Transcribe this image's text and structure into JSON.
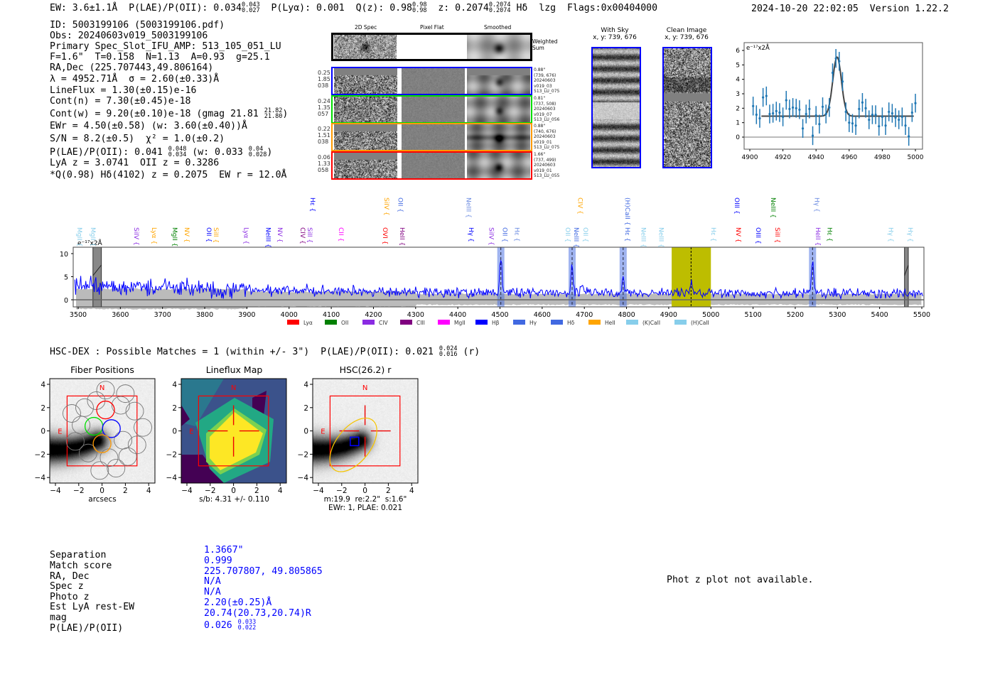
{
  "header": {
    "ew": "EW: 3.6±1.1Å",
    "plae_label": "P(LAE)/P(OII): 0.034",
    "plae_hi": "0.043",
    "plae_lo": "0.027",
    "plya": "P(Lyα): 0.001",
    "q_label": "Q(z): 0.98",
    "q_hi": "0.98",
    "q_lo": "0.98",
    "z_label": "z: 0.2074",
    "z_hi": "0.2074",
    "z_lo": "0.2074",
    "line": "Hδ",
    "lzg": "lzg",
    "flags": "Flags:0x00404000",
    "datetime": "2024-10-20 22:02:05",
    "version": "Version 1.22.2"
  },
  "info": {
    "lines": [
      "ID: 5003199106 (5003199106.pdf)",
      "Obs: 20240603v019_5003199106",
      "Primary Spec_Slot_IFU_AMP: 513_105_051_LU",
      "F=1.6\"  T=0.158  N=1.13  A=0.93  g=25.1",
      "RA,Dec (225.707443,49.806164)",
      "λ = 4952.71Å  σ = 2.60(±0.33)Å",
      "LineFlux = 1.30(±0.15)e-16",
      "Cont(n) = 7.30(±0.45)e-18"
    ],
    "contw": "Cont(w) = 9.20(±0.10)e-18 (gmag 21.81",
    "contw_hi": "21.82",
    "contw_lo": "21.80",
    "contw_end": ")",
    "ewr": "EWr = 4.50(±0.58) (w: 3.60(±0.40))Å",
    "sn": "S/N = 8.2(±0.5)  χ² = 1.0(±0.2)",
    "plae": "P(LAE)/P(OII): 0.041",
    "plae_hi": "0.048",
    "plae_lo": "0.034",
    "plae_w": "(w: 0.033",
    "plae_w_hi": "0.04",
    "plae_w_lo": "0.028",
    "plae_end": ")",
    "lyaz": "LyA z = 3.0741  OII z = 0.3286",
    "q": "*Q(0.98) Hδ(4102) z = 0.2075  EW r = 12.0Å"
  },
  "cutouts": {
    "col_headers": [
      "2D Spec",
      "Pixel Flat",
      "Smoothed"
    ],
    "weighted_sum": "Weighted\nSum",
    "rows": [
      {
        "color": "#0000ff",
        "left": "0.25\n1.85\n038",
        "right": "0.88\"\n(739, 676)\n20240603\nv019_03\n513_LU_075"
      },
      {
        "color": "#00dd00",
        "left": "0.24\n1.35\n057",
        "right": "0.81\"\n(737, 508)\n20240603\nv019_07\n513_LU_056"
      },
      {
        "color": "#ff9900",
        "left": "0.22\n1.51\n038",
        "right": "0.88\"\n(740, 676)\n20240603\nv019_01\n513_LU_075"
      },
      {
        "color": "#ff0000",
        "left": "0.06\n1.33\n058",
        "right": "1.66\"\n(737, 499)\n20240603\nv019_01\n513_LU_055"
      }
    ]
  },
  "sky": {
    "with_sky": "With Sky",
    "with_sky_xy": "x, y: 739, 676",
    "clean": "Clean Image",
    "clean_xy": "x, y: 739, 676"
  },
  "chart_data": [
    {
      "type": "scatter",
      "title": "",
      "unit_label": "e⁻¹⁷x2Å",
      "xlim": [
        4900,
        5000
      ],
      "ylim": [
        -0.9,
        6.4
      ],
      "xticks": [
        4900,
        4920,
        4940,
        4960,
        4980,
        5000
      ],
      "yticks": [
        0,
        1,
        2,
        3,
        4,
        5,
        6
      ],
      "x_start": 4902,
      "x_step": 2,
      "y": [
        2.15,
        1.55,
        1.3,
        2.75,
        2.85,
        1.6,
        1.65,
        1.8,
        1.7,
        1.4,
        2.55,
        1.95,
        2.05,
        2.0,
        1.9,
        0.6,
        1.6,
        1.95,
        0.1,
        1.5,
        0.9,
        2.1,
        1.6,
        2.05,
        4.45,
        5.45,
        5.25,
        3.85,
        1.75,
        1.0,
        0.95,
        0.8,
        1.95,
        2.4,
        2.0,
        1.2,
        1.55,
        1.55,
        0.75,
        1.4,
        0.8,
        1.75,
        1.65,
        1.35,
        1.2,
        1.4,
        0.8,
        0.05,
        1.7,
        2.35
      ],
      "yerr": 0.65,
      "fit": {
        "type": "gaussian",
        "center": 4952.71,
        "sigma": 2.6,
        "continuum": 1.45,
        "peak": 5.55,
        "range": [
          4907,
          4999
        ]
      },
      "colors": {
        "points": "#1f77b4",
        "fit": "#444444"
      }
    },
    {
      "type": "line",
      "title": "",
      "unit_label": "e⁻¹⁷x2Å",
      "xlim": [
        3490,
        5505
      ],
      "ylim": [
        -1.6,
        11.5
      ],
      "xticks": [
        3500,
        3600,
        3700,
        3800,
        3900,
        4000,
        4100,
        4200,
        4300,
        4400,
        4500,
        4600,
        4700,
        4800,
        4900,
        5000,
        5100,
        5200,
        5300,
        5400,
        5500
      ],
      "yticks": [
        0,
        5,
        10
      ],
      "continuum": [
        [
          3500,
          3.0
        ],
        [
          3700,
          2.8
        ],
        [
          3850,
          2.3
        ],
        [
          4000,
          2.0
        ],
        [
          4300,
          1.6
        ],
        [
          4500,
          1.5
        ],
        [
          5000,
          1.4
        ],
        [
          5500,
          1.4
        ]
      ],
      "emission_peaks": [
        [
          4502,
          9.5
        ],
        [
          4671,
          8.0
        ],
        [
          4696,
          3.6
        ],
        [
          4792,
          5.0
        ],
        [
          4953,
          4.0
        ],
        [
          5241,
          8.5
        ]
      ],
      "highlight_lines": [
        4502,
        4671,
        4792,
        5241
      ],
      "fit_window": [
        4907,
        5000
      ],
      "line_center": 4953,
      "masked": [
        [
          3535,
          3555
        ],
        [
          5459,
          5468
        ]
      ],
      "colors": {
        "spectrum": "#0000ff",
        "error": "#bbbbbb",
        "fit_window": "#bdbd00",
        "highlight": "#4169e1"
      },
      "line_labels": [
        {
          "w": 3493,
          "n": "MgII",
          "c": "#87ceeb"
        },
        {
          "w": 3525,
          "n": "MgII",
          "c": "#87ceeb"
        },
        {
          "w": 3628,
          "n": "SiIV",
          "c": "#8a2be2"
        },
        {
          "w": 3670,
          "n": "Lyα",
          "c": "#ffa500"
        },
        {
          "w": 3719,
          "n": "MgII",
          "c": "#008000"
        },
        {
          "w": 3748,
          "n": "NV",
          "c": "#ffa500"
        },
        {
          "w": 3800,
          "n": "OII",
          "c": "#0000ff"
        },
        {
          "w": 3817,
          "n": "SiII",
          "c": "#ffa500"
        },
        {
          "w": 3888,
          "n": "Lyα",
          "c": "#8a2be2"
        },
        {
          "w": 3941,
          "n": "NeIII",
          "c": "#0000ff"
        },
        {
          "w": 3968,
          "n": "NV",
          "c": "#8a2be2"
        },
        {
          "w": 4022,
          "n": "CIV",
          "c": "#800080"
        },
        {
          "w": 4039,
          "n": "SiII",
          "c": "#8a2be2"
        },
        {
          "w": 4113,
          "n": "CII",
          "c": "#ff00ff"
        },
        {
          "w": 4218,
          "n": "OVI",
          "c": "#ff0000"
        },
        {
          "w": 4258,
          "n": "HeII",
          "c": "#800080"
        },
        {
          "w": 4422,
          "n": "Hγ",
          "c": "#0000ff"
        },
        {
          "w": 4470,
          "n": "SiIV",
          "c": "#8a2be2"
        },
        {
          "w": 4502,
          "n": "OII",
          "c": "#4169e1"
        },
        {
          "w": 4530,
          "n": "Hε",
          "c": "#6a8ae1"
        },
        {
          "w": 4651,
          "n": "OII",
          "c": "#87ceeb"
        },
        {
          "w": 4671,
          "n": "NeIII",
          "c": "#4169e1"
        },
        {
          "w": 4693,
          "n": "OII",
          "c": "#87ceeb"
        },
        {
          "w": 4792,
          "n": "Hε",
          "c": "#4169e1"
        },
        {
          "w": 4830,
          "n": "NeIII",
          "c": "#87ceeb"
        },
        {
          "w": 4872,
          "n": "NeIII",
          "c": "#87ceeb"
        },
        {
          "w": 4996,
          "n": "Hε",
          "c": "#87ceeb"
        },
        {
          "w": 5055,
          "n": "NV",
          "c": "#ff0000"
        },
        {
          "w": 5102,
          "n": "OIII",
          "c": "#0000ff"
        },
        {
          "w": 5148,
          "n": "SiII",
          "c": "#ff0000"
        },
        {
          "w": 5244,
          "n": "HeII",
          "c": "#8a2be2"
        },
        {
          "w": 5272,
          "n": "Hε",
          "c": "#008000"
        },
        {
          "w": 5417,
          "n": "Hγ",
          "c": "#87ceeb"
        },
        {
          "w": 5463,
          "n": "Hγ",
          "c": "#87ceeb"
        },
        {
          "w": 4046,
          "n": "Hε",
          "c": "#0000ff",
          "stacked": true
        },
        {
          "w": 4221,
          "n": "SiIV",
          "c": "#ffa500",
          "stacked": true
        },
        {
          "w": 4254,
          "n": "OII",
          "c": "#4169e1",
          "stacked": true
        },
        {
          "w": 4416,
          "n": "NeIII",
          "c": "#6a8ae1",
          "stacked": true
        },
        {
          "w": 4680,
          "n": "CIV",
          "c": "#ffa500",
          "stacked": true
        },
        {
          "w": 4792,
          "n": "(H)CaII",
          "c": "#4169e1",
          "stacked": true
        },
        {
          "w": 5052,
          "n": "OIII",
          "c": "#0000ff",
          "stacked": true
        },
        {
          "w": 5138,
          "n": "NeIII",
          "c": "#008000",
          "stacked": true
        },
        {
          "w": 5241,
          "n": "Hγ",
          "c": "#6a8ae1",
          "stacked": true
        }
      ],
      "legend": [
        {
          "n": "Lyα",
          "c": "#ff0000"
        },
        {
          "n": "OII",
          "c": "#008000"
        },
        {
          "n": "CIV",
          "c": "#8a2be2"
        },
        {
          "n": "CIII",
          "c": "#800080"
        },
        {
          "n": "MgII",
          "c": "#ff00ff"
        },
        {
          "n": "Hβ",
          "c": "#0000ff"
        },
        {
          "n": "Hγ",
          "c": "#4169e1"
        },
        {
          "n": "Hδ",
          "c": "#4169e1"
        },
        {
          "n": "HeII",
          "c": "#ffa500"
        },
        {
          "n": "(K)CaII",
          "c": "#87ceeb"
        },
        {
          "n": "(H)CaII",
          "c": "#87ceeb"
        }
      ]
    }
  ],
  "hsc": {
    "summary": "HSC-DEX : Possible Matches = 1 (within +/- 3\")  P(LAE)/P(OII): 0.021",
    "summary_hi": "0.024",
    "summary_lo": "0.016",
    "summary_end": "(r)",
    "panels": [
      {
        "title": "Fiber Positions",
        "xlabel": "arcsecs"
      },
      {
        "title": "Lineflux Map",
        "xlabel": "s/b: 4.31 +/- 0.110"
      },
      {
        "title": "HSC(26.2) r",
        "xlabel": "m:19.9  re:2.2\"  s:1.6\"",
        "xlabel2": "EWr: 1, PLAE: 0.021"
      }
    ],
    "ticks": [
      "−4",
      "−2",
      "0",
      "2",
      "4"
    ],
    "north": "N",
    "east": "E"
  },
  "match": {
    "labels": [
      "Separation",
      "Match score",
      "RA, Dec",
      "Spec z",
      "Photo z",
      "Est LyA rest-EW",
      "mag",
      "P(LAE)/P(OII)"
    ],
    "values": [
      "1.3667\"",
      "0.999",
      "225.707807, 49.805865",
      "N/A",
      "N/A",
      "2.20(±0.25)Å",
      "20.74(20.73,20.74)R",
      "0.026"
    ],
    "plae_hi": "0.033",
    "plae_lo": "0.022"
  },
  "photz": "Phot z plot not available."
}
